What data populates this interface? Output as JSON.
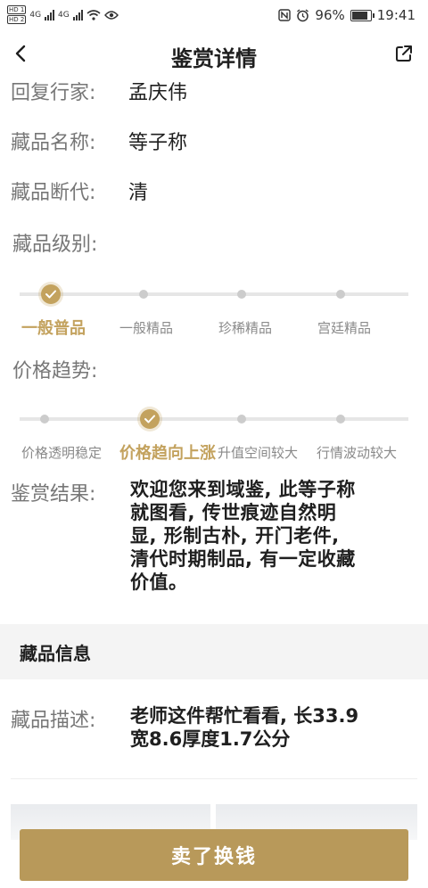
{
  "status_bar": {
    "network_labels": [
      "HD 1",
      "HD 2",
      "4G",
      "4G"
    ],
    "battery_text": "96%",
    "battery_level": 0.96,
    "time": "19:41"
  },
  "header": {
    "title": "鉴赏详情",
    "back_icon": "chevron-left-icon",
    "share_icon": "share-icon"
  },
  "details": {
    "appraiser_label": "回复行家:",
    "appraiser_value": "孟庆伟",
    "name_label": "藏品名称:",
    "name_value": "等子称",
    "dating_label": "藏品断代:",
    "dating_value": "清",
    "grade_label": "藏品级别:",
    "trend_label": "价格趋势:"
  },
  "grade_levels": {
    "items": [
      "一般普品",
      "一般精品",
      "珍稀精品",
      "宫廷精品"
    ],
    "selected_index": 0
  },
  "trend_levels": {
    "items": [
      "价格透明稳定",
      "价格趋向上涨",
      "升值空间较大",
      "行情波动较大"
    ],
    "selected_index": 1
  },
  "result": {
    "label": "鉴赏结果:",
    "lines": [
      "欢迎您来到域鉴, 此等子称",
      "就图看, 传世痕迹自然明",
      "显, 形制古朴, 开门老件,",
      "清代时期制品, 有一定收藏",
      "价值。"
    ]
  },
  "collection_info": {
    "section_title": "藏品信息",
    "description_label": "藏品描述:",
    "description_lines": [
      "老师这件帮忙看看, 长33.9",
      "宽8.6厚度1.7公分"
    ]
  },
  "cta": {
    "label": "卖了换钱"
  },
  "colors": {
    "accent": "#c3a25e",
    "cta": "#b8995a"
  }
}
